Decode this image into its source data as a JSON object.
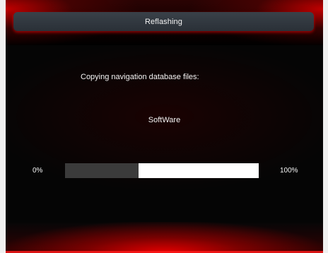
{
  "header": {
    "title": "Reflashing"
  },
  "status": {
    "message": "Copying navigation database files:",
    "item": "SoftWare"
  },
  "progress": {
    "min_label": "0%",
    "max_label": "100%",
    "value": 0.38
  },
  "colors": {
    "accent": "#d00000",
    "background": "#060607",
    "progress_fill": "#3b3b3b",
    "progress_track": "#ffffff"
  }
}
